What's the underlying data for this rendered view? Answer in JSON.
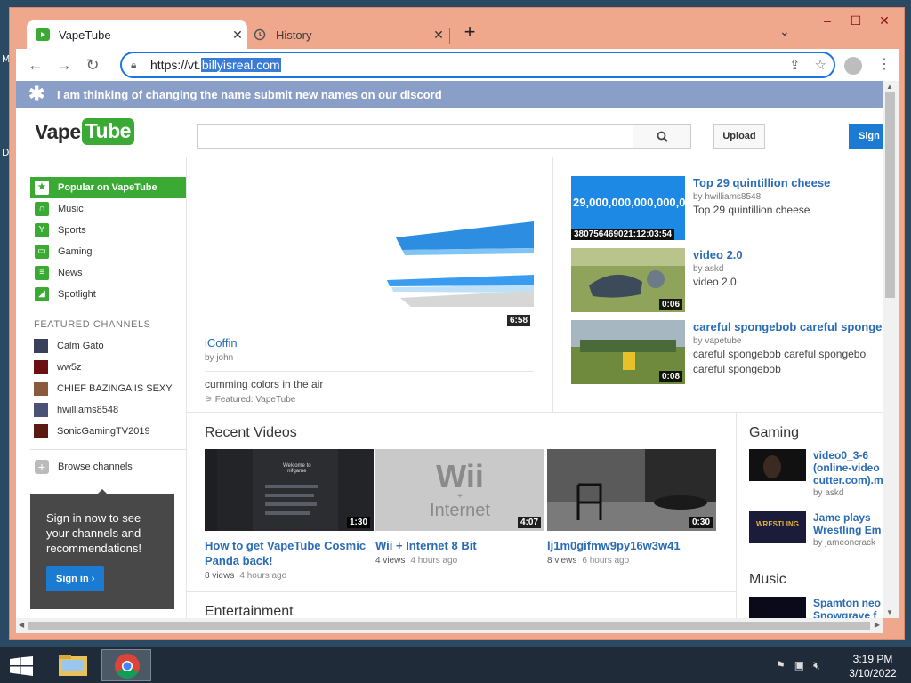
{
  "desktop": {
    "frag1": "M",
    "frag2": "D"
  },
  "browser": {
    "tabs": [
      {
        "title": "VapeTube",
        "active": true
      },
      {
        "title": "History",
        "active": false
      }
    ],
    "url_prefix": "https://vt.",
    "url_highlight": "billyisreal.com"
  },
  "banner": {
    "text": "I am thinking of changing the name submit new names on our discord"
  },
  "header": {
    "logo_left": "Vape",
    "logo_right": "Tube",
    "upload": "Upload",
    "signin": "Sign"
  },
  "sidebar": {
    "nav": [
      {
        "label": "Popular on VapeTube",
        "icon": "star-icon",
        "active": true
      },
      {
        "label": "Music",
        "icon": "headphones-icon"
      },
      {
        "label": "Sports",
        "icon": "trophy-icon"
      },
      {
        "label": "Gaming",
        "icon": "gamepad-icon"
      },
      {
        "label": "News",
        "icon": "newspaper-icon"
      },
      {
        "label": "Spotlight",
        "icon": "spotlight-icon"
      }
    ],
    "featured_heading": "FEATURED CHANNELS",
    "channels": [
      {
        "name": "Calm Gato",
        "color": "#3a3f5a"
      },
      {
        "name": "ww5z",
        "color": "#6b0f12"
      },
      {
        "name": "CHIEF BAZINGA IS SEXY",
        "color": "#8a5a3c"
      },
      {
        "name": "hwilliams8548",
        "color": "#4b5277"
      },
      {
        "name": "SonicGamingTV2019",
        "color": "#5a1a10"
      }
    ],
    "browse": "Browse channels",
    "promo_text": "Sign in now to see your channels and recommendations!",
    "promo_button": "Sign in ›"
  },
  "featured": {
    "duration": "6:58",
    "title": "iCoffin",
    "by": "by john",
    "description": "cumming colors in the air",
    "featured_by": "Featured: VapeTube"
  },
  "right_videos": [
    {
      "title": "Top 29 quintillion cheese",
      "by": "by hwilliams8548",
      "desc1": "Top 29 quintillion cheese",
      "desc2": "",
      "thumb_text": "29,000,000,000,000,000,000",
      "duration": "380756469021:12:03:54"
    },
    {
      "title": "video 2.0",
      "by": "by askd",
      "desc1": "video 2.0",
      "desc2": "",
      "thumb_text": "",
      "duration": "0:06"
    },
    {
      "title": "careful spongebob careful sponge",
      "by": "by vapetube",
      "desc1": "careful spongebob careful spongebo",
      "desc2": "careful spongebob",
      "thumb_text": "",
      "duration": "0:08"
    }
  ],
  "recent": {
    "heading": "Recent Videos",
    "videos": [
      {
        "title": "How to get VapeTube Cosmic Panda back!",
        "views": "8 views",
        "ago": "4 hours ago",
        "duration": "1:30",
        "thumb_text": ""
      },
      {
        "title": "Wii + Internet 8 Bit",
        "views": "4 views",
        "ago": "4 hours ago",
        "duration": "4:07",
        "thumb_text": "Wii"
      },
      {
        "title": "lj1m0gifmw9py16w3w41",
        "views": "8 views",
        "ago": "6 hours ago",
        "duration": "0:30",
        "thumb_text": ""
      }
    ],
    "wii_plus": "+",
    "wii_internet": "Internet",
    "discord_welcome": "Welcome to",
    "discord_server": "nifgame"
  },
  "entertainment": {
    "heading": "Entertainment"
  },
  "gaming": {
    "heading": "Gaming",
    "items": [
      {
        "title": "video0_3-6 (online-video cutter.com).m",
        "by": "by askd"
      },
      {
        "title": "Jame plays Wrestling Em",
        "by": "by jameoncrack",
        "thumb_text": "WRESTLING"
      }
    ]
  },
  "music": {
    "heading": "Music",
    "items": [
      {
        "title": "Spamton neo Snowgrave f"
      }
    ]
  },
  "taskbar": {
    "time": "3:19 PM",
    "date": "3/10/2022"
  }
}
